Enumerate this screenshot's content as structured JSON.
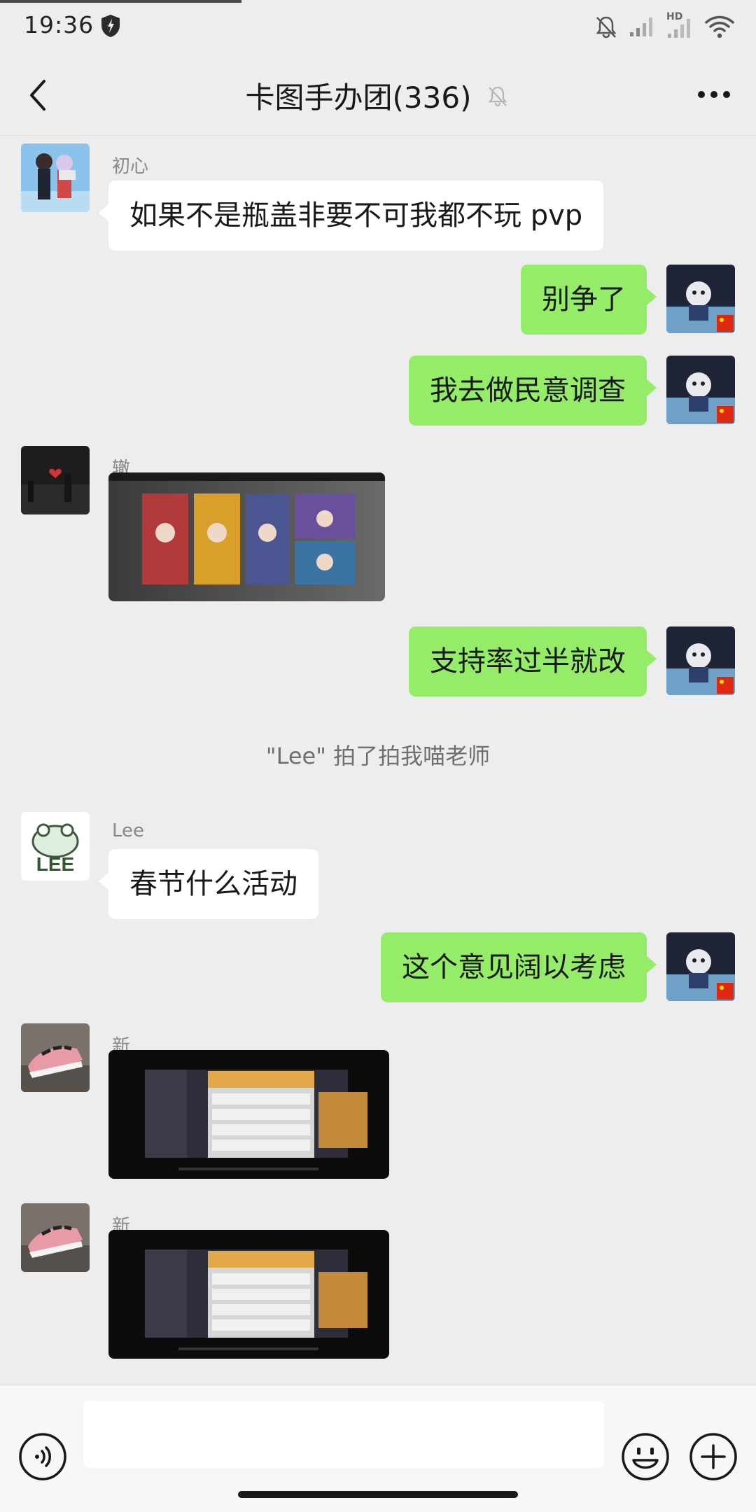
{
  "status_bar": {
    "time": "19:36",
    "icons": [
      "shield-icon",
      "mute-bell-icon",
      "signal-icon",
      "hd-signal-icon",
      "wifi-icon"
    ],
    "hd_label": "HD"
  },
  "header": {
    "title": "卡图手办团(336)",
    "muted_icon": "bell-off-icon",
    "back_icon": "chevron-left-icon",
    "more_icon": "more-dots-icon"
  },
  "messages": [
    {
      "type": "text",
      "direction": "in",
      "sender": "初心",
      "text": "如果不是瓶盖非要不可我都不玩 pvp"
    },
    {
      "type": "text",
      "direction": "out",
      "text": "别争了"
    },
    {
      "type": "text",
      "direction": "out",
      "text": "我去做民意调查"
    },
    {
      "type": "image",
      "direction": "in",
      "sender": "辙"
    },
    {
      "type": "text",
      "direction": "out",
      "text": "支持率过半就改"
    },
    {
      "type": "system",
      "text": "\"Lee\" 拍了拍我喵老师"
    },
    {
      "type": "text",
      "direction": "in",
      "sender": "Lee",
      "text": "春节什么活动"
    },
    {
      "type": "text",
      "direction": "out",
      "text": "这个意见阔以考虑"
    },
    {
      "type": "image",
      "direction": "in",
      "sender": "新"
    },
    {
      "type": "image",
      "direction": "in",
      "sender": "新"
    }
  ],
  "avatars": {
    "lee_avatar_text": "LEE"
  },
  "input_bar": {
    "voice_icon": "voice-icon",
    "input_value": "",
    "emoji_icon": "emoji-icon",
    "plus_icon": "plus-icon"
  },
  "colors": {
    "background": "#ededed",
    "outgoing_bubble": "#95ec69",
    "incoming_bubble": "#ffffff",
    "sender_name": "#888888"
  }
}
